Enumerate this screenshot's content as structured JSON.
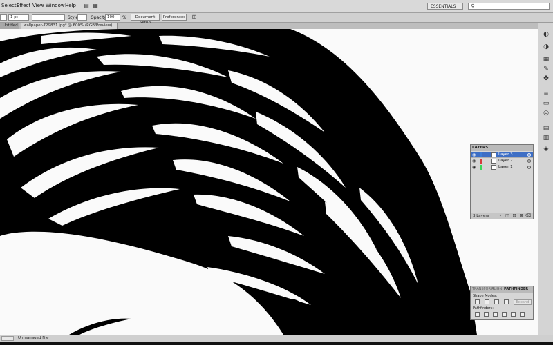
{
  "menubar": {
    "items": [
      "Select",
      "Effect",
      "View",
      "Window",
      "Help"
    ],
    "workspace": "ESSENTIALS"
  },
  "controlbar": {
    "stroke_weight": "1 pt",
    "style_label": "Style:",
    "opacity_label": "Opacity:",
    "opacity_value": "100",
    "opacity_unit": "%",
    "document_setup": "Document Setup",
    "preferences": "Preferences"
  },
  "tabs": {
    "left_partial": "Untitled",
    "active": "wallpaper-729831.jpg* @ 600% (RGB/Preview)"
  },
  "layers_panel": {
    "title": "LAYERS",
    "layers": [
      {
        "name": "Layer 3",
        "color": "#3b7bd6",
        "selected": true
      },
      {
        "name": "Layer 2",
        "color": "#d63b3b",
        "selected": false
      },
      {
        "name": "Layer 1",
        "color": "#3bd65a",
        "selected": false
      }
    ],
    "count": "3 Layers"
  },
  "pathfinder_panel": {
    "tabs": [
      "TRANSFORM",
      "ALIGN",
      "PATHFINDER"
    ],
    "shape_modes_label": "Shape Modes:",
    "pathfinders_label": "Pathfinders:",
    "expand_label": "Expand"
  },
  "statusbar": {
    "text": "Unmanaged File"
  },
  "colors": {
    "selection": "#3d6ec5",
    "artwork": "#000000",
    "canvas": "#fafafa"
  }
}
